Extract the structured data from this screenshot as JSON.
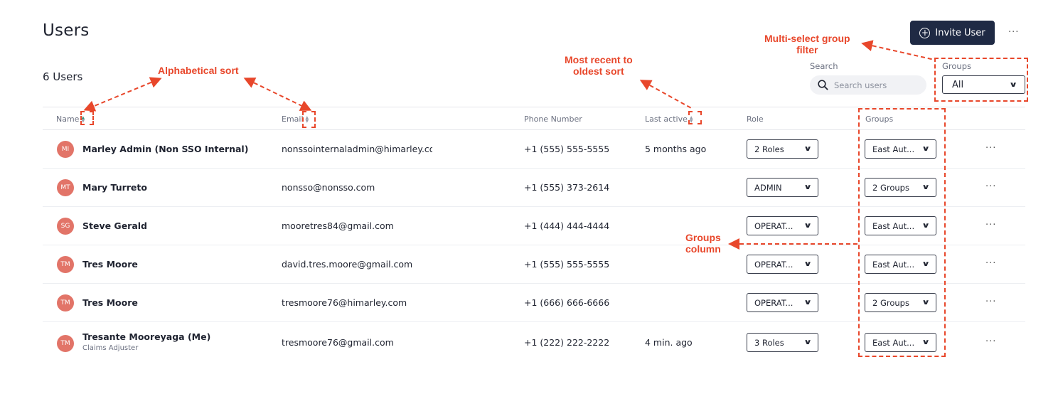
{
  "header": {
    "title": "Users",
    "count": "6 Users",
    "invite_label": "Invite User",
    "more": "···"
  },
  "search": {
    "label": "Search",
    "placeholder": "Search users"
  },
  "groups_filter": {
    "label": "Groups",
    "value": "All"
  },
  "columns": {
    "name": "Name",
    "email": "Email",
    "phone": "Phone Number",
    "last_active": "Last active",
    "role": "Role",
    "groups": "Groups"
  },
  "rows": [
    {
      "initials": "MI",
      "name": "Marley Admin (Non SSO Internal)",
      "subtitle": "",
      "email": "nonssointernaladmin@himarley.com",
      "phone": "+1 (555) 555-5555",
      "last_active": "5 months ago",
      "role": "2 Roles",
      "groups": "East Aut...",
      "more": "···"
    },
    {
      "initials": "MT",
      "name": "Mary Turreto",
      "subtitle": "",
      "email": "nonsso@nonsso.com",
      "phone": "+1 (555) 373-2614",
      "last_active": "",
      "role": "ADMIN",
      "groups": "2 Groups",
      "more": "···"
    },
    {
      "initials": "SG",
      "name": "Steve Gerald",
      "subtitle": "",
      "email": "mooretres84@gmail.com",
      "phone": "+1 (444) 444-4444",
      "last_active": "",
      "role": "OPERAT...",
      "groups": "East Aut...",
      "more": "···"
    },
    {
      "initials": "TM",
      "name": "Tres Moore",
      "subtitle": "",
      "email": "david.tres.moore@gmail.com",
      "phone": "+1 (555) 555-5555",
      "last_active": "",
      "role": "OPERAT...",
      "groups": "East Aut...",
      "more": "···"
    },
    {
      "initials": "TM",
      "name": "Tres Moore",
      "subtitle": "",
      "email": "tresmoore76@himarley.com",
      "phone": "+1 (666) 666-6666",
      "last_active": "",
      "role": "OPERAT...",
      "groups": "2 Groups",
      "more": "···"
    },
    {
      "initials": "TM",
      "name": "Tresante Mooreyaga (Me)",
      "subtitle": "Claims Adjuster",
      "email": "tresmoore76@gmail.com",
      "phone": "+1 (222) 222-2222",
      "last_active": "4 min. ago",
      "role": "3 Roles",
      "groups": "East Aut...",
      "more": "···"
    }
  ],
  "annotations": {
    "alpha_sort": "Alphabetical sort",
    "recent_sort": "Most recent to\noldest sort",
    "group_filter": "Multi-select group\nfilter",
    "groups_column": "Groups\ncolumn"
  },
  "colors": {
    "accent": "#1f2a44",
    "avatar": "#e27468",
    "annotation": "#e8472b",
    "sort_active": "#3b8e7e"
  }
}
